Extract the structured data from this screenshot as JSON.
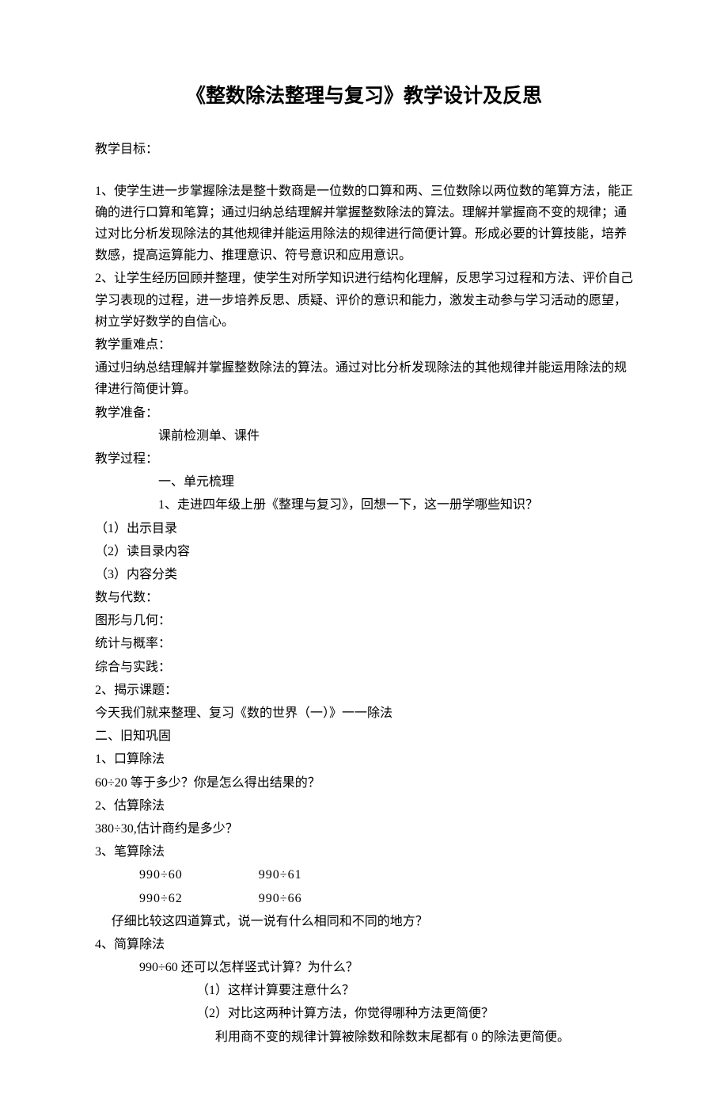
{
  "title": "《整数除法整理与复习》教学设计及反思",
  "label_obj": "教学目标：",
  "obj_p1": "1、使学生进一步掌握除法是整十数商是一位数的口算和两、三位数除以两位数的笔算方法，能正确的进行口算和笔算；通过归纳总结理解并掌握整数除法的算法。理解并掌握商不变的规律；通过对比分析发现除法的其他规律并能运用除法的规律进行简便计算。形成必要的计算技能，培养数感，提高运算能力、推理意识、符号意识和应用意识。",
  "obj_p2": "2、让学生经历回顾并整理，使学生对所学知识进行结构化理解，反思学习过程和方法、评价自己学习表现的过程，进一步培养反思、质疑、评价的意识和能力，激发主动参与学习活动的愿望，树立学好数学的自信心。",
  "label_diff": "教学重难点：",
  "diff_p": "通过归纳总结理解并掌握整数除法的算法。通过对比分析发现除法的其他规律并能运用除法的规律进行简便计算。",
  "label_prep": "教学准备：",
  "prep_p": "课前检测单、课件",
  "label_proc": "教学过程：",
  "sec1_h": "一、单元梳理",
  "sec1_1": "1、走进四年级上册《整理与复习》，回想一下，这一册学哪些知识？",
  "s1_a": "（1）出示目录",
  "s1_b": "（2）读目录内容",
  "s1_c": "（3）内容分类",
  "cat1": "数与代数：",
  "cat2": "图形与几何：",
  "cat3": "统计与概率：",
  "cat4": "综合与实践：",
  "sec1_2h": "2、揭示课题：",
  "sec1_2p": "今天我们就来整理、复习《数的世界（一）》一一除法",
  "sec2_h": "二、旧知巩固",
  "sec2_1h": "1、口算除法",
  "sec2_1p": "60÷20 等于多少？你是怎么得出结果的？",
  "sec2_2h": "2、估算除法",
  "sec2_2p": "380÷30,估计商约是多少？",
  "sec2_3h": "3、笔算除法",
  "calc_a1": "990÷60",
  "calc_a2": "990÷61",
  "calc_b1": "990÷62",
  "calc_b2": "990÷66",
  "sec2_3q": "仔细比较这四道算式，说一说有什么相同和不同的地方？",
  "sec2_4h": "4、简算除法",
  "sec2_4p": "990÷60 还可以怎样竖式计算？为什么？",
  "sec2_4a": "（1）这样计算要注意什么？",
  "sec2_4b": "（2）对比这两种计算方法，你觉得哪种方法更简便？",
  "sec2_4c": "利用商不变的规律计算被除数和除数末尾都有 0 的除法更简便。"
}
